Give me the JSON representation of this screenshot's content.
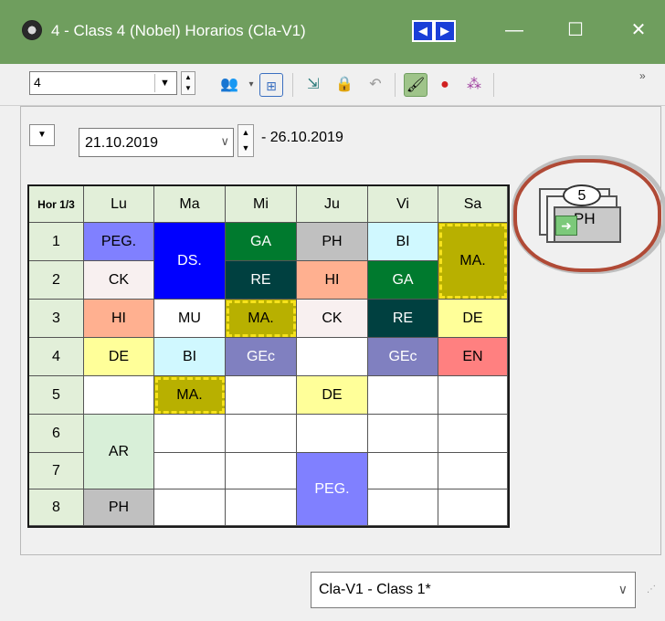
{
  "window": {
    "title": "4 - Class 4 (Nobel)  Horarios  (Cla-V1)",
    "prev_icon": "triangle-left-icon",
    "next_icon": "triangle-right-icon",
    "minimize": "—",
    "maximize": "☐",
    "close": "✕"
  },
  "toolbar": {
    "class_selector_value": "4",
    "overflow": "»"
  },
  "date_range": {
    "start": "21.10.2019",
    "end": "- 26.10.2019"
  },
  "timetable": {
    "corner_label": "Hor 1/3",
    "days": [
      "Lu",
      "Ma",
      "Mi",
      "Ju",
      "Vi",
      "Sa"
    ],
    "hours": [
      "1",
      "2",
      "3",
      "4",
      "5",
      "6",
      "7",
      "8"
    ],
    "lessons": [
      {
        "subject": "PEG.",
        "color": "#8080ff"
      },
      {
        "subject": "DS.",
        "color": "#0000ff"
      },
      {
        "subject": "GA",
        "color": "#007a2e"
      },
      {
        "subject": "PH",
        "color": "#c0c0c0"
      },
      {
        "subject": "BI",
        "color": "#d0f8ff"
      },
      {
        "subject": "MA.",
        "color": "#b8b000"
      },
      {
        "subject": "CK",
        "color": "#f8f0f0"
      },
      {
        "subject": "RE",
        "color": "#004040"
      },
      {
        "subject": "HI",
        "color": "#ffb090"
      },
      {
        "subject": "GA",
        "color": "#007a2e"
      },
      {
        "subject": "HI",
        "color": "#ffb090"
      },
      {
        "subject": "MU",
        "color": "#ffffff"
      },
      {
        "subject": "MA.",
        "color": "#b8b000"
      },
      {
        "subject": "CK",
        "color": "#f8f0f0"
      },
      {
        "subject": "RE",
        "color": "#004040"
      },
      {
        "subject": "DE",
        "color": "#ffff99"
      },
      {
        "subject": "DE",
        "color": "#ffff99"
      },
      {
        "subject": "BI",
        "color": "#d0f8ff"
      },
      {
        "subject": "GEc",
        "color": "#8080c0"
      },
      {
        "subject": "GEc",
        "color": "#8080c0"
      },
      {
        "subject": "EN",
        "color": "#ff8080"
      },
      {
        "subject": "MA.",
        "color": "#b8b000"
      },
      {
        "subject": "DE",
        "color": "#ffff99"
      },
      {
        "subject": "AR",
        "color": "#d8efd8"
      },
      {
        "subject": "PEG.",
        "color": "#8080ff"
      },
      {
        "subject": "PH",
        "color": "#c0c0c0"
      }
    ]
  },
  "unplanned": {
    "count": "5",
    "subject": "PH"
  },
  "bottom_selector": {
    "value": "Cla-V1 - Class 1*"
  }
}
